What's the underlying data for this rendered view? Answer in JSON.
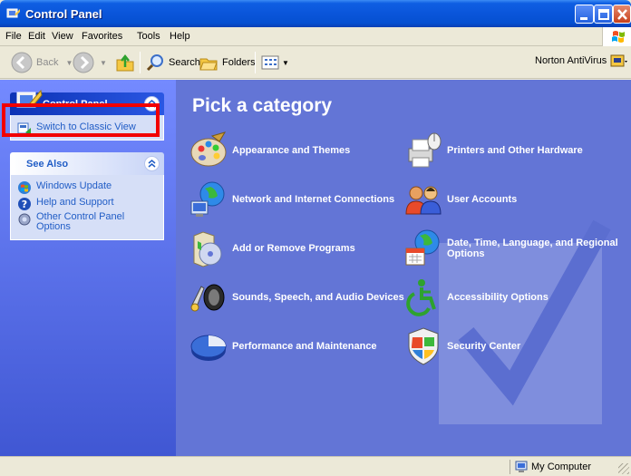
{
  "window": {
    "title": "Control Panel"
  },
  "menu": [
    "File",
    "Edit",
    "View",
    "Favorites",
    "Tools",
    "Help"
  ],
  "toolbar": {
    "back": "Back",
    "search": "Search",
    "folders": "Folders",
    "norton": "Norton AntiVirus"
  },
  "sidebar": {
    "control_panel": {
      "title": "Control Panel",
      "switch_view": "Switch to Classic View"
    },
    "see_also": {
      "title": "See Also",
      "items": [
        "Windows Update",
        "Help and Support",
        "Other Control Panel Options"
      ]
    }
  },
  "main": {
    "heading": "Pick a category",
    "categories": [
      {
        "label": "Appearance and Themes",
        "icon": "appearance-themes-icon"
      },
      {
        "label": "Printers and Other Hardware",
        "icon": "printers-hardware-icon"
      },
      {
        "label": "Network and Internet Connections",
        "icon": "network-icon"
      },
      {
        "label": "User Accounts",
        "icon": "user-accounts-icon"
      },
      {
        "label": "Add or Remove Programs",
        "icon": "add-remove-programs-icon"
      },
      {
        "label": "Date, Time, Language, and Regional Options",
        "icon": "date-time-language-icon"
      },
      {
        "label": "Sounds, Speech, and Audio Devices",
        "icon": "sounds-icon"
      },
      {
        "label": "Accessibility Options",
        "icon": "accessibility-icon"
      },
      {
        "label": "Performance and Maintenance",
        "icon": "performance-icon"
      },
      {
        "label": "Security Center",
        "icon": "security-center-icon"
      }
    ]
  },
  "status": {
    "zone": "My Computer"
  },
  "colors": {
    "highlight": "#F20000",
    "pane": "#6375D6",
    "link": "#215DC6"
  }
}
